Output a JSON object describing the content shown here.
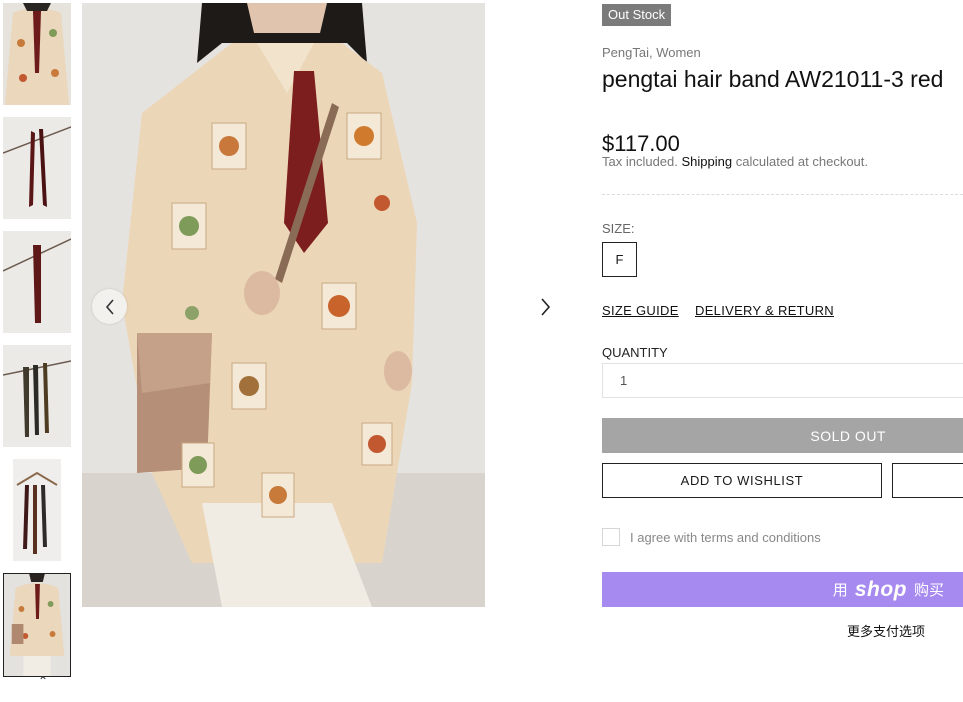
{
  "product": {
    "badge": "Out Stock",
    "vendor": "PengTai, Women",
    "title": "pengtai hair band AW21011-3 red",
    "price": "$117.00",
    "tax_prefix": "Tax included.",
    "tax_link": "Shipping",
    "tax_suffix": "calculated at checkout."
  },
  "size": {
    "label": "SIZE:",
    "options": [
      "F"
    ]
  },
  "links": {
    "size_guide": "SIZE GUIDE",
    "delivery": "DELIVERY & RETURN"
  },
  "quantity": {
    "label": "QUANTITY",
    "value": "1"
  },
  "buttons": {
    "sold_out": "SOLD OUT",
    "wishlist": "ADD TO WISHLIST",
    "shop_pay_prefix": "用",
    "shop_pay_brand": "shop",
    "shop_pay_suffix": "购买",
    "more_payment": "更多支付选项"
  },
  "terms": {
    "text": "I agree with terms and conditions",
    "checked": false
  },
  "gallery": {
    "thumbnails": [
      "model-in-printed-shirt",
      "red-band-hanging",
      "red-band-hanging-2",
      "bands-on-branch",
      "bands-on-hanger",
      "model-in-printed-shirt-full"
    ],
    "active_index": 5,
    "prev_icon": "chevron-left-icon",
    "next_icon": "chevron-right-icon",
    "thumb_up_icon": "chevron-up-icon"
  },
  "colors": {
    "badge_bg": "#7b7b7b",
    "sold_out_bg": "#a5a5a5",
    "shop_pay_bg": "#a68af0"
  }
}
